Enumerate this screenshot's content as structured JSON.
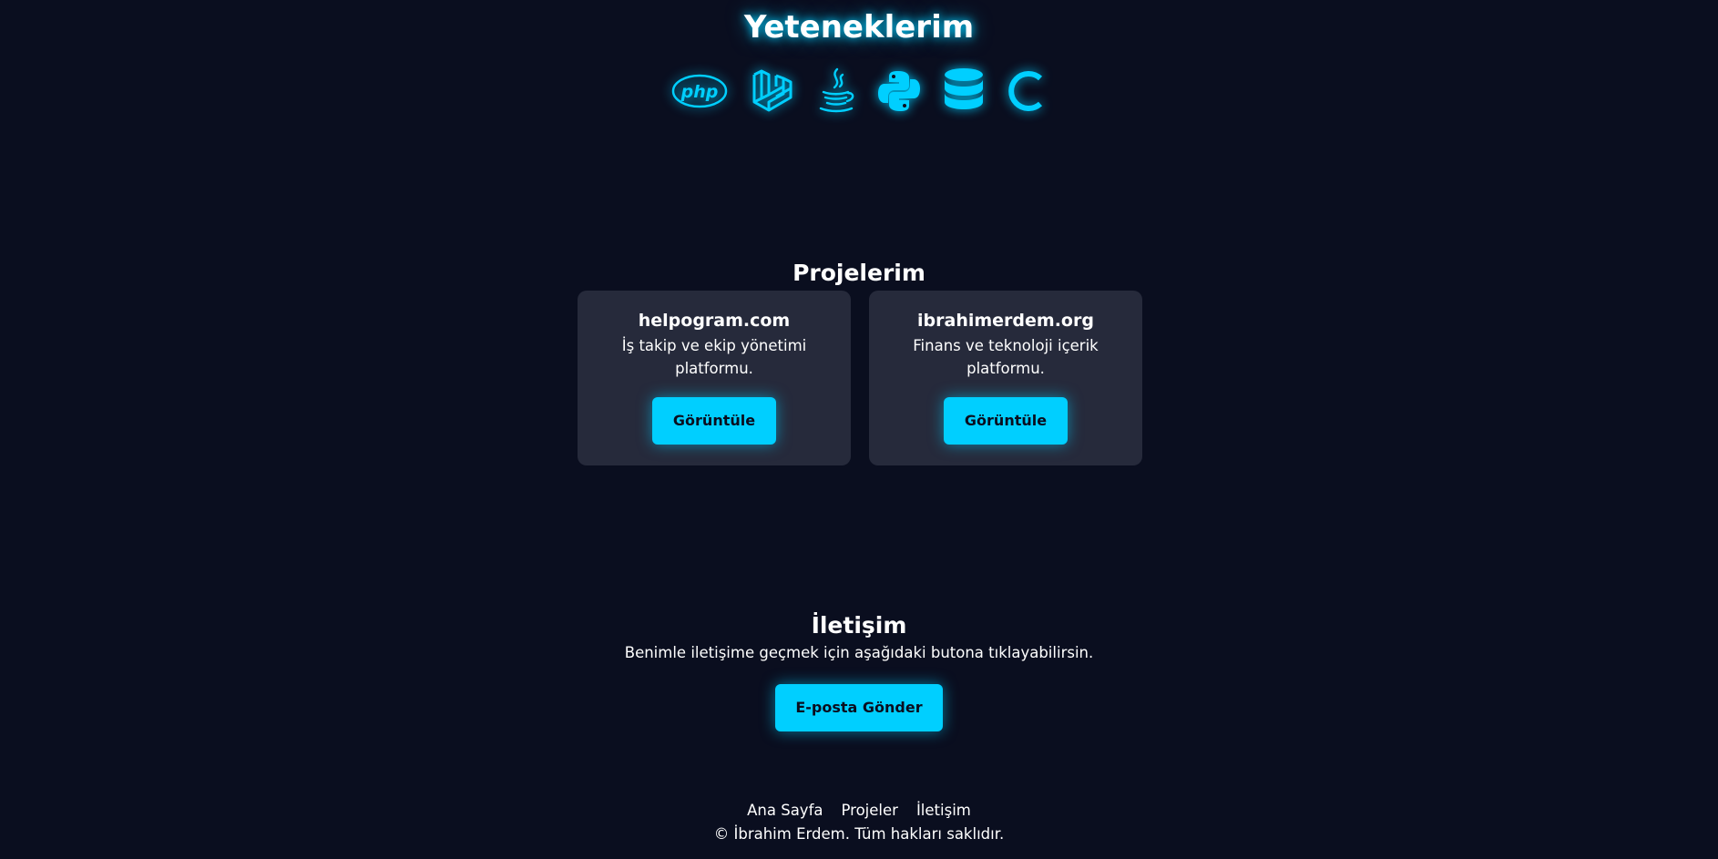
{
  "skills": {
    "title": "Yeteneklerim",
    "icons": [
      "php-icon",
      "laravel-icon",
      "java-icon",
      "python-icon",
      "database-icon",
      "c-language-icon"
    ],
    "php_label": "php"
  },
  "projects": {
    "title": "Projelerim",
    "items": [
      {
        "name": "helpogram.com",
        "description": "İş takip ve ekip yönetimi platformu.",
        "button_label": "Görüntüle"
      },
      {
        "name": "ibrahimerdem.org",
        "description": "Finans ve teknoloji içerik platformu.",
        "button_label": "Görüntüle"
      }
    ]
  },
  "contact": {
    "title": "İletişim",
    "text": "Benimle iletişime geçmek için aşağıdaki butona tıklayabilirsin.",
    "button_label": "E-posta Gönder"
  },
  "footer": {
    "links": [
      "Ana Sayfa",
      "Projeler",
      "İletişim"
    ],
    "copyright": "© İbrahim Erdem. Tüm hakları saklıdır."
  },
  "colors": {
    "background": "#0a0e1f",
    "accent": "#00cfff",
    "card": "#262a3b"
  }
}
